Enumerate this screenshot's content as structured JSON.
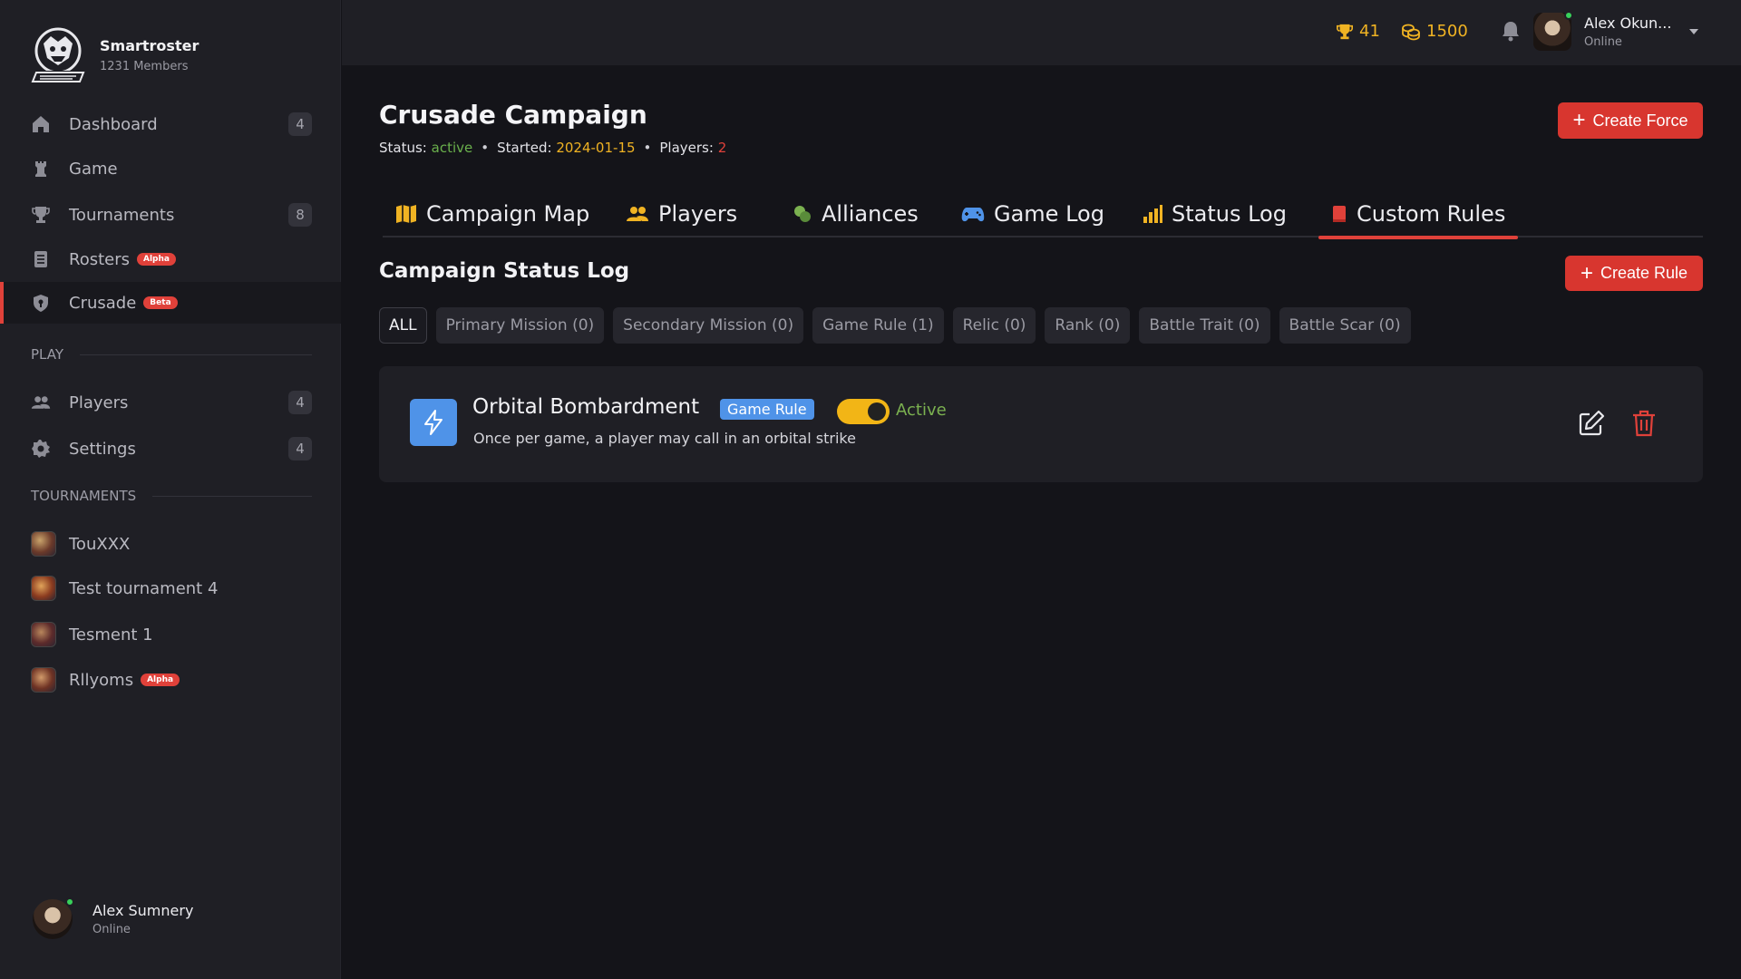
{
  "brand": {
    "name": "Smartroster",
    "members": "1231 Members"
  },
  "sidebar": {
    "items": [
      {
        "label": "Dashboard",
        "count": "4",
        "icon": "home-icon"
      },
      {
        "label": "Game",
        "icon": "chess-rook-icon"
      },
      {
        "label": "Tournaments",
        "count": "8",
        "icon": "trophy-icon"
      },
      {
        "label": "Rosters",
        "badge": "Alpha",
        "icon": "list-icon"
      },
      {
        "label": "Crusade",
        "badge": "Beta",
        "icon": "shield-icon",
        "active": true
      }
    ],
    "play_heading": "PLAY",
    "play_items": [
      {
        "label": "Players",
        "count": "4",
        "icon": "users-icon"
      },
      {
        "label": "Settings",
        "count": "4",
        "icon": "gear-icon"
      }
    ],
    "tournaments_heading": "TOURNAMENTS",
    "tournaments": [
      {
        "label": "TouXXX"
      },
      {
        "label": "Test tournament 4"
      },
      {
        "label": "Tesment 1"
      },
      {
        "label": "Rllyoms",
        "badge": "Alpha"
      }
    ],
    "user": {
      "name": "Alex Sumnery",
      "status": "Online"
    }
  },
  "topbar": {
    "trophies": "41",
    "coins": "1500",
    "user": {
      "name": "Alex Okun...",
      "status": "Online"
    }
  },
  "campaign": {
    "title": "Crusade Campaign",
    "status_label": "Status:",
    "status_value": "active",
    "started_label": "Started:",
    "started_value": "2024-01-15",
    "players_label": "Players:",
    "players_value": "2",
    "create_force": "Create Force"
  },
  "tabs": [
    {
      "label": "Campaign Map",
      "icon": "map-icon"
    },
    {
      "label": "Players",
      "icon": "users-icon"
    },
    {
      "label": "Alliances",
      "icon": "alliance-icon"
    },
    {
      "label": "Game Log",
      "icon": "gamepad-icon"
    },
    {
      "label": "Status Log",
      "icon": "bar-chart-icon"
    },
    {
      "label": "Custom Rules",
      "icon": "book-icon",
      "active": true
    }
  ],
  "section": {
    "title": "Campaign Status Log",
    "create_rule": "Create Rule"
  },
  "filters": [
    "ALL",
    "Primary Mission (0)",
    "Secondary Mission (0)",
    "Game Rule (1)",
    "Relic (0)",
    "Rank (0)",
    "Battle Trait (0)",
    "Battle Scar (0)"
  ],
  "rules": [
    {
      "name": "Orbital Bombardment",
      "type": "Game Rule",
      "state": "Active",
      "enabled": true,
      "description": "Once per game, a player may call in an orbital strike",
      "icon": "lightning-icon"
    }
  ],
  "colors": {
    "accent": "#e0413a",
    "gold": "#f0b323",
    "blue": "#4f93e8",
    "green": "#6ab04c"
  }
}
